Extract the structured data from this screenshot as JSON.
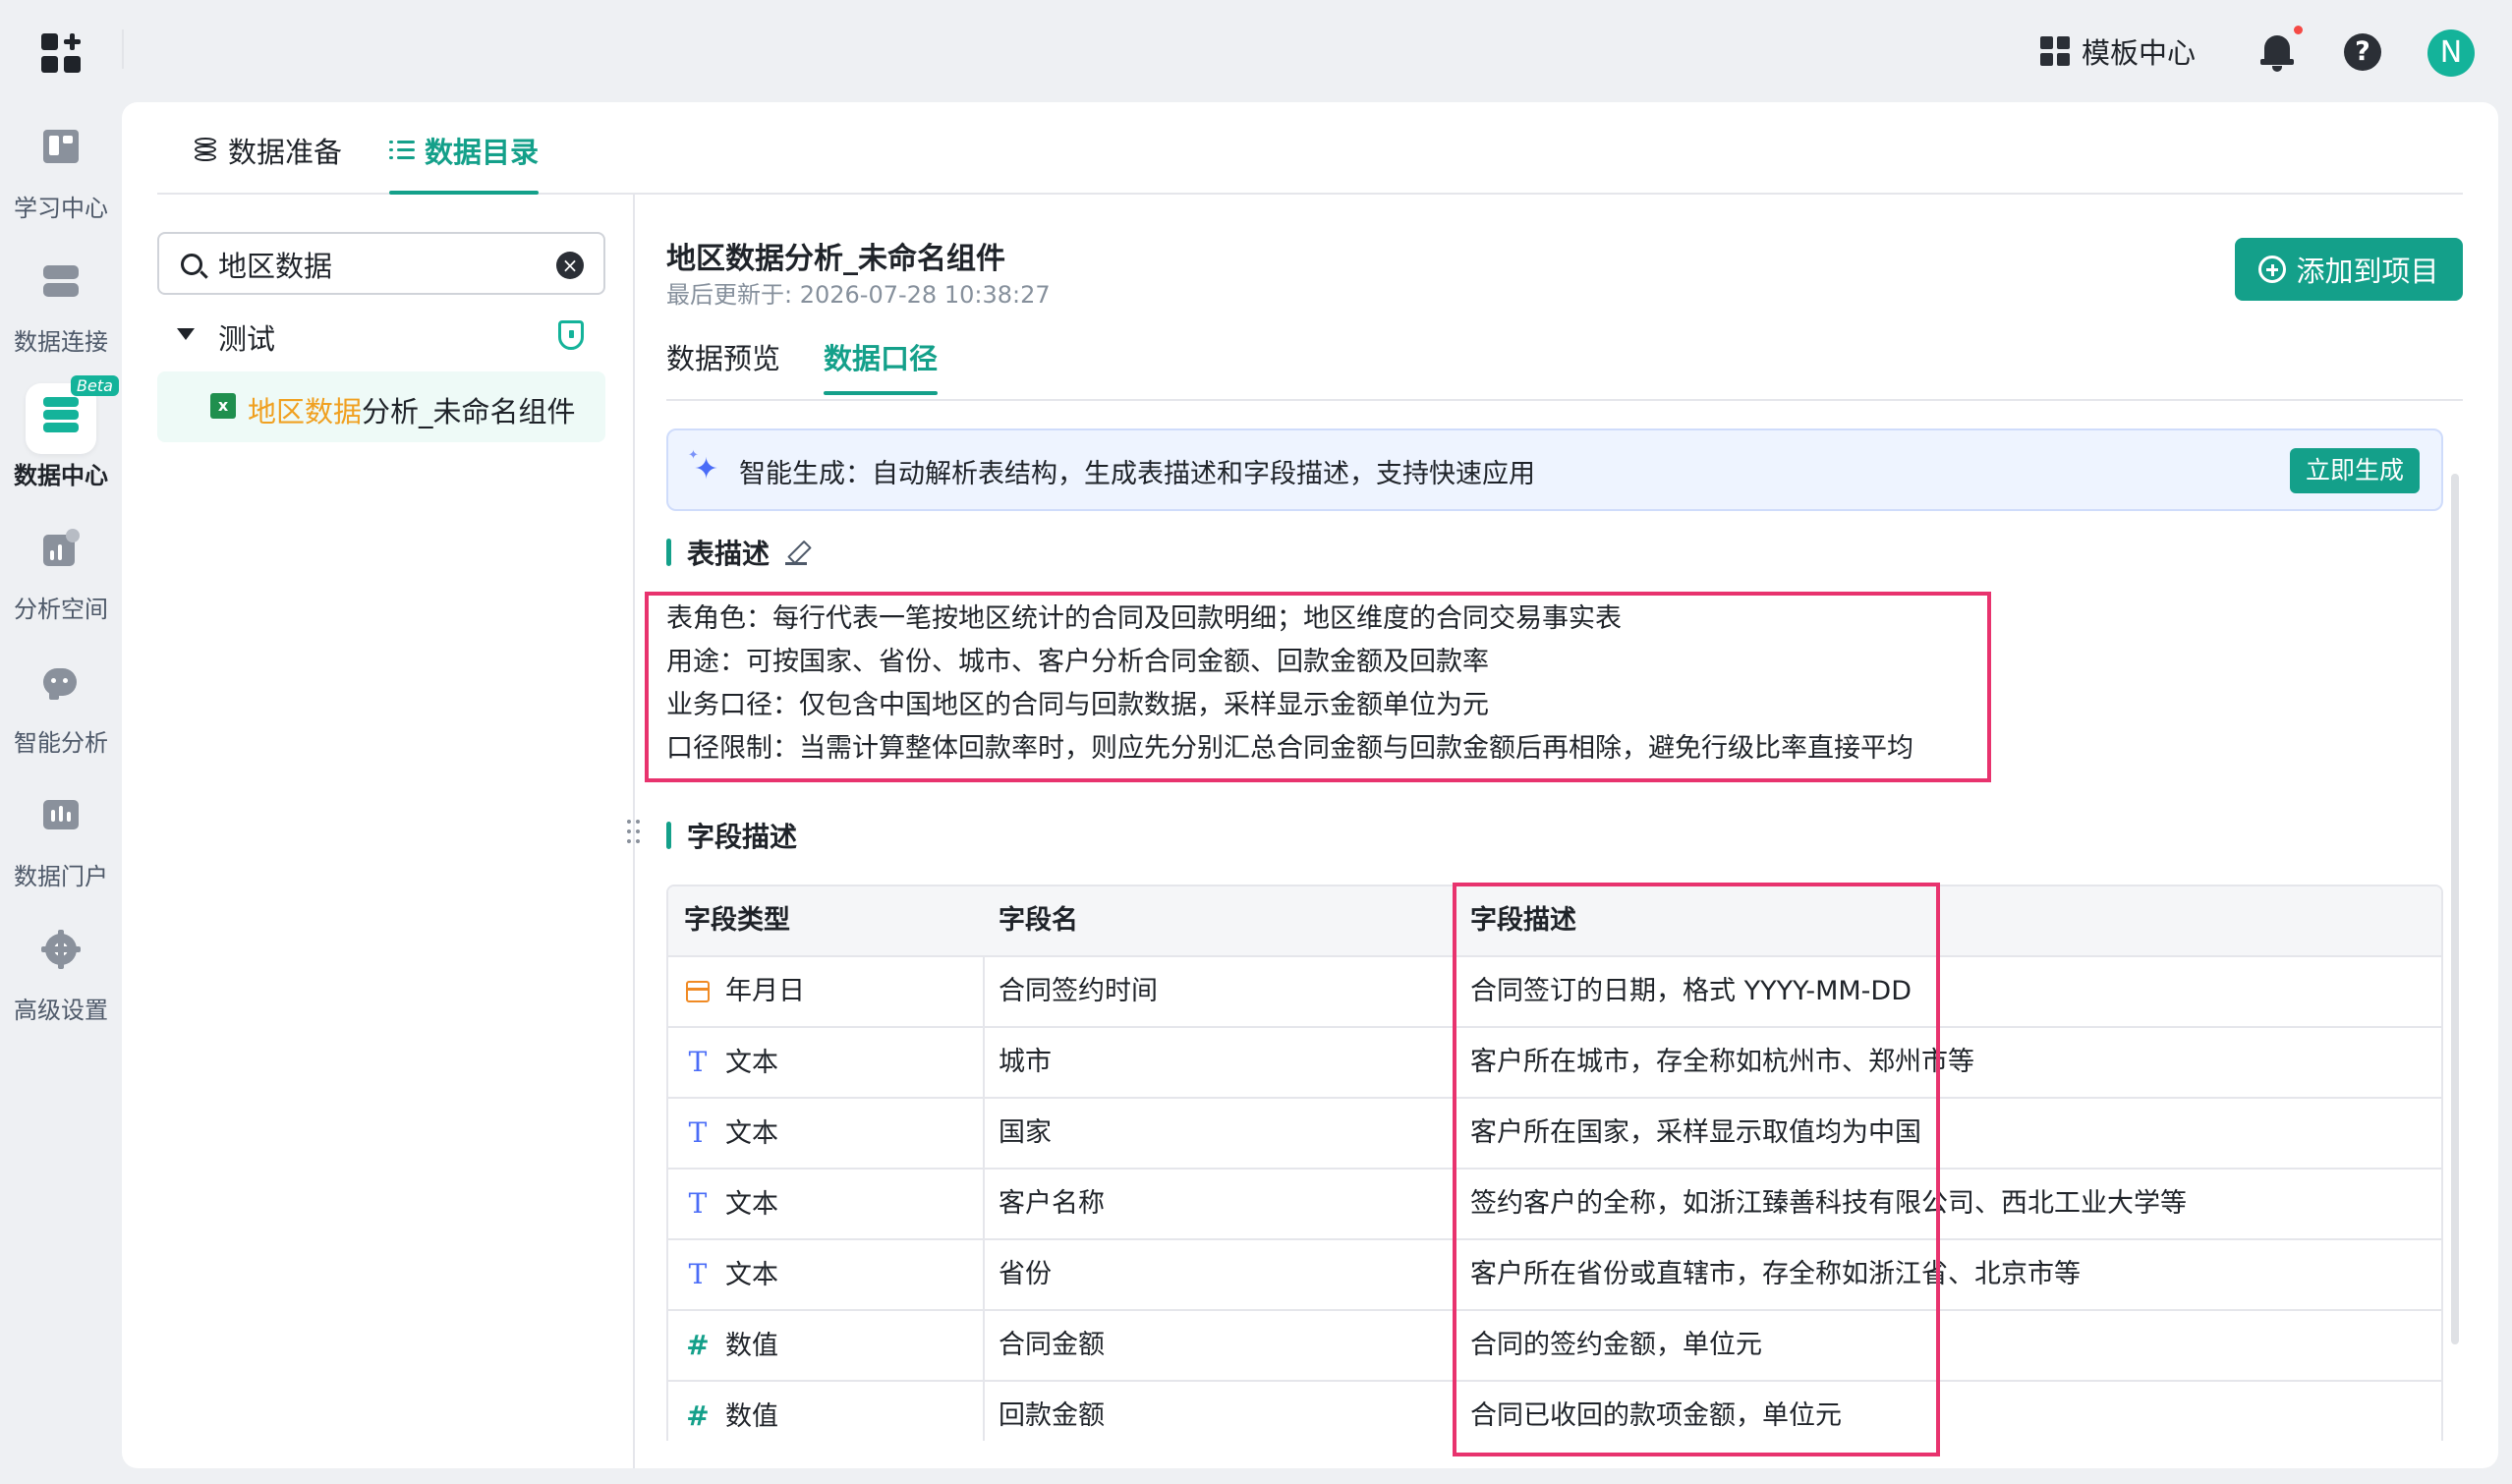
{
  "header": {
    "template_center_label": "模板中心",
    "avatar_initial": "N",
    "help_glyph": "?"
  },
  "nav": {
    "items": [
      {
        "label": "学习中心",
        "icon": "book-icon"
      },
      {
        "label": "数据连接",
        "icon": "server-icon"
      },
      {
        "label": "数据中心",
        "icon": "database-icon",
        "badge": "Beta",
        "active": true
      },
      {
        "label": "分析空间",
        "icon": "chart-icon"
      },
      {
        "label": "智能分析",
        "icon": "bot-icon"
      },
      {
        "label": "数据门户",
        "icon": "portal-icon"
      },
      {
        "label": "高级设置",
        "icon": "gear-icon"
      }
    ]
  },
  "top_tabs": [
    {
      "label": "数据准备",
      "icon": "database-icon"
    },
    {
      "label": "数据目录",
      "icon": "list-icon",
      "active": true
    }
  ],
  "tree": {
    "search_value": "地区数据",
    "folder": "测试",
    "leaf_highlight": "地区数据",
    "leaf_rest": "分析_未命名组件"
  },
  "detail": {
    "title": "地区数据分析_未命名组件",
    "updated": "最后更新于: 2026-07-28 10:38:27",
    "add_button": "添加到项目",
    "subtabs": [
      "数据预览",
      "数据口径"
    ],
    "active_subtab": "数据口径",
    "ai_banner": "智能生成：自动解析表结构，生成表描述和字段描述，支持快速应用",
    "generate_button": "立即生成",
    "table_desc_title": "表描述",
    "table_desc_lines": [
      "表角色：每行代表一笔按地区统计的合同及回款明细；地区维度的合同交易事实表",
      "用途：可按国家、省份、城市、客户分析合同金额、回款金额及回款率",
      "业务口径：仅包含中国地区的合同与回款数据，采样显示金额单位为元",
      "口径限制：当需计算整体回款率时，则应先分别汇总合同金额与回款金额后再相除，避免行级比率直接平均"
    ],
    "field_desc_title": "字段描述",
    "columns": [
      "字段类型",
      "字段名",
      "字段描述"
    ],
    "rows": [
      {
        "type": "年月日",
        "type_icon": "calendar-icon",
        "name": "合同签约时间",
        "desc": "合同签订的日期，格式 YYYY-MM-DD"
      },
      {
        "type": "文本",
        "type_icon": "text-icon",
        "name": "城市",
        "desc": "客户所在城市，存全称如杭州市、郑州市等"
      },
      {
        "type": "文本",
        "type_icon": "text-icon",
        "name": "国家",
        "desc": "客户所在国家，采样显示取值均为中国"
      },
      {
        "type": "文本",
        "type_icon": "text-icon",
        "name": "客户名称",
        "desc": "签约客户的全称，如浙江臻善科技有限公司、西北工业大学等"
      },
      {
        "type": "文本",
        "type_icon": "text-icon",
        "name": "省份",
        "desc": "客户所在省份或直辖市，存全称如浙江省、北京市等"
      },
      {
        "type": "数值",
        "type_icon": "number-icon",
        "name": "合同金额",
        "desc": "合同的签约金额，单位元"
      },
      {
        "type": "数值",
        "type_icon": "number-icon",
        "name": "回款金额",
        "desc": "合同已收回的款项金额，单位元"
      }
    ]
  }
}
